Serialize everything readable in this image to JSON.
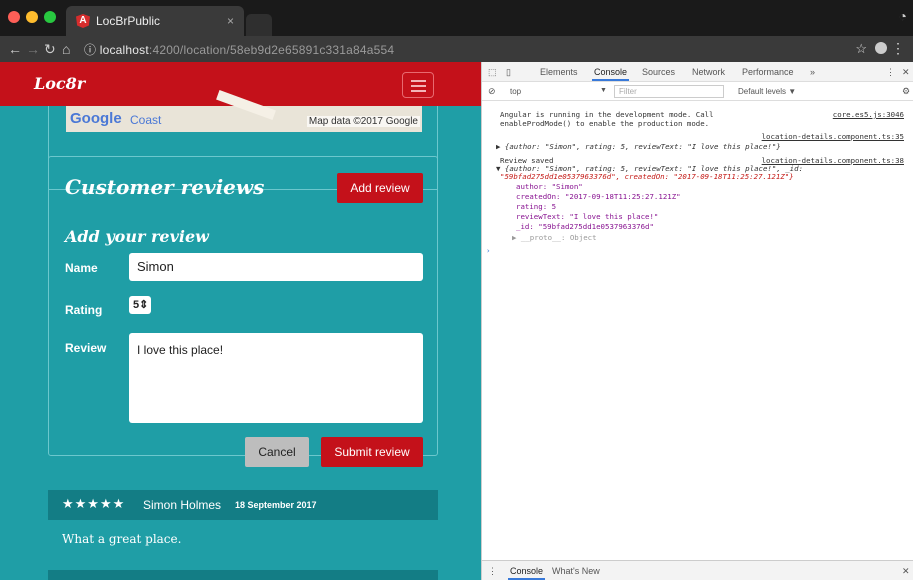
{
  "browser": {
    "tab_title": "LocBrPublic",
    "tab_close": "×",
    "url_host": "localhost",
    "url_rest": ":4200/location/58eb9d2e65891c331a84a554"
  },
  "app": {
    "brand": "Loc8r",
    "map": {
      "google": "Google",
      "coast": "Coast",
      "data": "Map data ©2017 Google"
    },
    "reviews_title": "Customer reviews",
    "add_review_label": "Add review",
    "form": {
      "title": "Add your review",
      "name_label": "Name",
      "name_value": "Simon",
      "rating_label": "Rating",
      "rating_value": "5",
      "review_label": "Review",
      "review_value": "I love this place!",
      "cancel_label": "Cancel",
      "submit_label": "Submit review"
    },
    "review": {
      "stars": "★★★★★",
      "author": "Simon Holmes",
      "date": "18 September 2017",
      "text": "What a great place."
    }
  },
  "devtools": {
    "tabs": [
      "Elements",
      "Console",
      "Sources",
      "Network",
      "Performance",
      "»"
    ],
    "context": "top",
    "filter_placeholder": "Filter",
    "levels": "Default levels ▼",
    "console": {
      "angular_msg1": "Angular is running in the development mode. Call",
      "angular_msg2": "enableProdMode() to enable the production mode.",
      "core_link": "core.es5.js:3046",
      "loc_link1": "location-details.component.ts:35",
      "obj1": "{author: \"Simon\", rating: 5, reviewText: \"I love this place!\"}",
      "saved_msg": "Review saved",
      "loc_link2": "location-details.component.ts:38",
      "obj2a": "{author: \"Simon\", rating: 5, reviewText: \"I love this place!\", _id:",
      "obj2b": "\"59bfad275dd1e0537963376d\", createdOn: \"2017-09-18T11:25:27.121Z\"}",
      "author": "author: \"Simon\"",
      "created": "createdOn: \"2017-09-18T11:25:27.121Z\"",
      "rating": "rating: 5",
      "reviewText": "reviewText: \"I love this place!\"",
      "id": "_id: \"59bfad275dd1e0537963376d\"",
      "proto": "▶ __proto__: Object"
    },
    "drawer_tabs": [
      "Console",
      "What's New"
    ]
  }
}
